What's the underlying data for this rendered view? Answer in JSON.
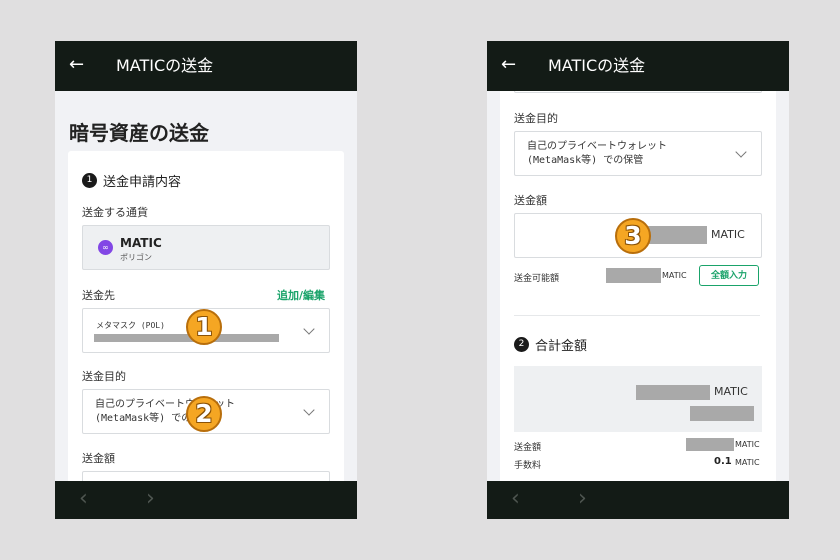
{
  "phone1": {
    "header": {
      "back_icon": "←",
      "title": "MATICの送金"
    },
    "page_title": "暗号資産の送金",
    "section1_num": "1",
    "section1_title": "送金申請内容",
    "currency_label": "送金する通貨",
    "currency_name": "MATIC",
    "currency_sub": "ポリゴン",
    "dest_label": "送金先",
    "dest_edit": "追加/編集",
    "dest_value": "メタマスク (POL)",
    "purpose_label": "送金目的",
    "purpose_value": "自己のプライベートウォレット (MetaMask等) での保管",
    "amount_label": "送金額",
    "marker1": "1",
    "marker2": "2",
    "nav_back": "‹",
    "nav_forward": "›"
  },
  "phone2": {
    "header": {
      "back_icon": "←",
      "title": "MATICの送金"
    },
    "purpose_label": "送金目的",
    "purpose_value": "自己のプライベートウォレット (MetaMask等) での保管",
    "amount_label": "送金額",
    "amount_unit": "MATIC",
    "marker3": "3",
    "available_label": "送金可能額",
    "available_unit": "MATIC",
    "full_amount_button": "全額入力",
    "section2_num": "2",
    "section2_title": "合計金額",
    "total_unit": "MATIC",
    "send_amount_label": "送金額",
    "send_amount_unit": "MATIC",
    "fee_label": "手数料",
    "fee_value": "0.1",
    "fee_unit": "MATIC",
    "nav_back": "‹",
    "nav_forward": "›"
  },
  "colors": {
    "appbar": "#131b16",
    "accent_green": "#1aa36a",
    "marker_orange": "#f5a623",
    "matic_purple": "#8247e5"
  }
}
